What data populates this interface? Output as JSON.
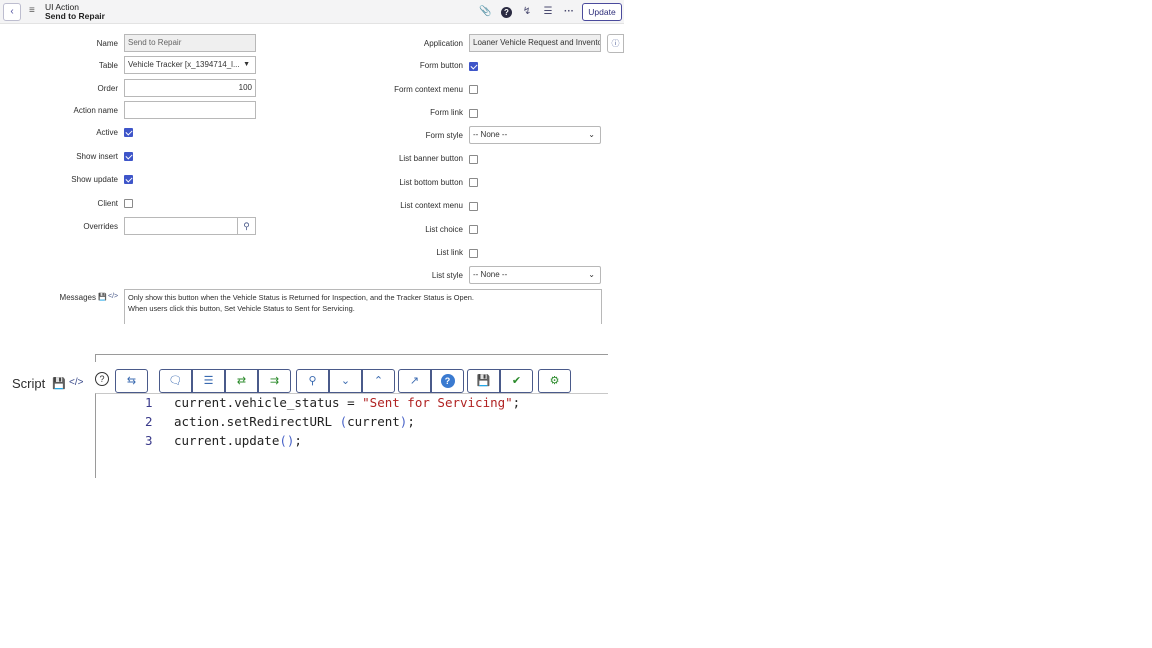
{
  "header": {
    "record_type": "UI Action",
    "record_name": "Send to Repair",
    "update_label": "Update",
    "icons": [
      "back-icon",
      "menu-icon",
      "paperclip-icon",
      "help-icon",
      "activity-icon",
      "settings-icon",
      "more-icon"
    ]
  },
  "left": {
    "name": {
      "label": "Name",
      "value": "Send to Repair"
    },
    "table": {
      "label": "Table",
      "value": "Vehicle Tracker [x_1394714_l..."
    },
    "order": {
      "label": "Order",
      "value": "100"
    },
    "action_name": {
      "label": "Action name",
      "value": ""
    },
    "active": {
      "label": "Active",
      "checked": true
    },
    "show_insert": {
      "label": "Show insert",
      "checked": true
    },
    "show_update": {
      "label": "Show update",
      "checked": true
    },
    "client": {
      "label": "Client",
      "checked": false
    },
    "overrides": {
      "label": "Overrides",
      "value": ""
    }
  },
  "right": {
    "application": {
      "label": "Application",
      "value": "Loaner Vehicle Request and Invento"
    },
    "form_button": {
      "label": "Form button",
      "checked": true
    },
    "form_context_menu": {
      "label": "Form context menu",
      "checked": false
    },
    "form_link": {
      "label": "Form link",
      "checked": false
    },
    "form_style": {
      "label": "Form style",
      "value": "-- None --"
    },
    "list_banner_button": {
      "label": "List banner button",
      "checked": false
    },
    "list_bottom_button": {
      "label": "List bottom button",
      "checked": false
    },
    "list_context_menu": {
      "label": "List context menu",
      "checked": false
    },
    "list_choice": {
      "label": "List choice",
      "checked": false
    },
    "list_link": {
      "label": "List link",
      "checked": false
    },
    "list_style": {
      "label": "List style",
      "value": "-- None --"
    }
  },
  "messages": {
    "label": "Messages",
    "line1": "Only show this button when the Vehicle Status is Returned for Inspection, and the Tracker Status is Open.",
    "line2": "When users click this button, Set Vehicle Status to Sent for Servicing."
  },
  "script": {
    "label": "Script",
    "toolbar_icons": [
      "toggle-syntax-icon",
      "comment-icon",
      "format-icon",
      "replace-icon",
      "replace-all-icon",
      "search-icon",
      "next-icon",
      "previous-icon",
      "fullscreen-icon",
      "help-icon",
      "save-icon",
      "check-icon",
      "debug-icon"
    ],
    "lines": [
      {
        "num": "1",
        "pre": "current.vehicle_status = ",
        "str": "\"Sent for Servicing\"",
        "post": ";"
      },
      {
        "num": "2",
        "pre": "action.setRedirectURL ",
        "paren_open": "(",
        "mid": "current",
        "paren_close": ")",
        "post": ";"
      },
      {
        "num": "3",
        "pre": "current.update",
        "paren_open": "()",
        "post": ";"
      }
    ]
  }
}
